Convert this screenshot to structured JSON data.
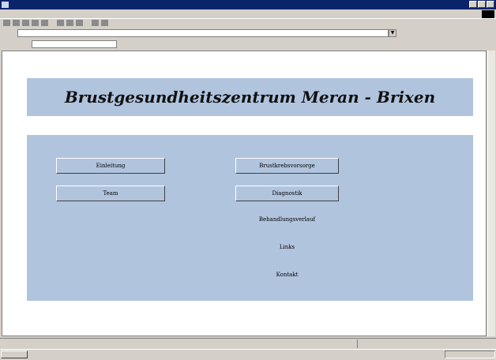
{
  "page": {
    "heading": "Brustgesundheitszentrum Meran - Brixen"
  },
  "nav": {
    "left_buttons": [
      {
        "label": "Einleitung"
      },
      {
        "label": "Team"
      }
    ],
    "right_buttons": [
      {
        "label": "Brustkrebsvorsorge"
      },
      {
        "label": "Diagnostik"
      }
    ],
    "links": [
      {
        "label": "Behandlungsverlauf"
      },
      {
        "label": "Links"
      },
      {
        "label": "Kontakt"
      }
    ]
  },
  "icons": {
    "app": "ie-icon",
    "minimize": "minimize-icon",
    "maximize": "maximize-icon",
    "close": "close-icon"
  }
}
